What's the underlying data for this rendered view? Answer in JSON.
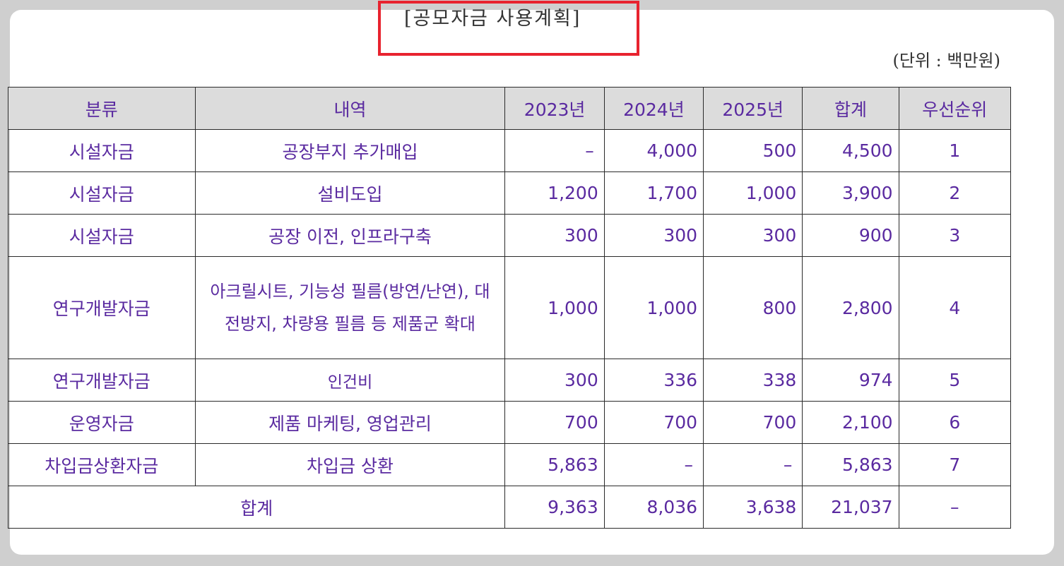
{
  "document": {
    "title": "[공모자금 사용계획]",
    "unit": "(단위 : 백만원)"
  },
  "table": {
    "headers": [
      "분류",
      "내역",
      "2023년",
      "2024년",
      "2025년",
      "합계",
      "우선순위"
    ],
    "rows": [
      {
        "category": "시설자금",
        "description": "공장부지 추가매입",
        "y2023": "–",
        "y2024": "4,000",
        "y2025": "500",
        "total": "4,500",
        "priority": "1"
      },
      {
        "category": "시설자금",
        "description": "설비도입",
        "y2023": "1,200",
        "y2024": "1,700",
        "y2025": "1,000",
        "total": "3,900",
        "priority": "2"
      },
      {
        "category": "시설자금",
        "description": "공장 이전, 인프라구축",
        "y2023": "300",
        "y2024": "300",
        "y2025": "300",
        "total": "900",
        "priority": "3"
      },
      {
        "category": "연구개발자금",
        "description": "아크릴시트, 기능성 필름(방연/난연), 대전방지, 차량용 필름 등 제품군 확대",
        "y2023": "1,000",
        "y2024": "1,000",
        "y2025": "800",
        "total": "2,800",
        "priority": "4"
      },
      {
        "category": "연구개발자금",
        "description": "인건비",
        "y2023": "300",
        "y2024": "336",
        "y2025": "338",
        "total": "974",
        "priority": "5"
      },
      {
        "category": "운영자금",
        "description": "제품 마케팅, 영업관리",
        "y2023": "700",
        "y2024": "700",
        "y2025": "700",
        "total": "2,100",
        "priority": "6"
      },
      {
        "category": "차입금상환자금",
        "description": "차입금 상환",
        "y2023": "5,863",
        "y2024": "–",
        "y2025": "–",
        "total": "5,863",
        "priority": "7"
      }
    ],
    "total_row": {
      "label": "합계",
      "y2023": "9,363",
      "y2024": "8,036",
      "y2025": "3,638",
      "total": "21,037",
      "priority": "–"
    }
  },
  "colors": {
    "text": "#5a2aa0",
    "header_bg": "#dcdcdc",
    "highlight_box": "#e8232f",
    "page_bg": "#cfcfcf"
  }
}
